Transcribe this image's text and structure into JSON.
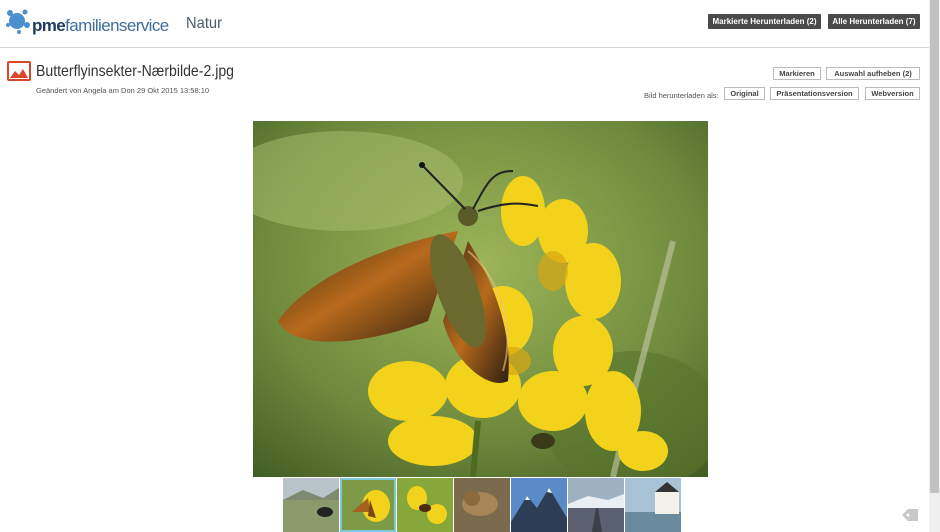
{
  "header": {
    "logo_pme": "pme",
    "logo_rest": "familienservice",
    "section": "Natur",
    "marked_download_label": "Markierte Herunterladen (2)",
    "all_download_label": "Alle Herunterladen (7)"
  },
  "file": {
    "name": "Butterflyinsekter-Nærbilde-2.jpg",
    "meta": "Geändert von Angela am Don 29 Okt 2015 13:58:10",
    "icon": "image-file-icon"
  },
  "actions": {
    "mark_label": "Markieren",
    "deselect_label": "Auswahl aufheben (2)",
    "download_as_label": "Bild herunterladen als:",
    "original_label": "Original",
    "presentation_label": "Präsentationsversion",
    "web_label": "Webversion"
  },
  "thumbnails": [
    {
      "subject": "bear",
      "selected": false
    },
    {
      "subject": "butterfly",
      "selected": true
    },
    {
      "subject": "insect-on-flower",
      "selected": false
    },
    {
      "subject": "lion",
      "selected": false
    },
    {
      "subject": "mountains",
      "selected": false
    },
    {
      "subject": "road-landscape",
      "selected": false
    },
    {
      "subject": "lighthouse",
      "selected": false
    }
  ],
  "colors": {
    "accent_dark": "#4a4a4a",
    "logo_blue": "#3e6d9c",
    "file_icon_red": "#d9472b",
    "selected_outline": "#7ec8d8"
  }
}
